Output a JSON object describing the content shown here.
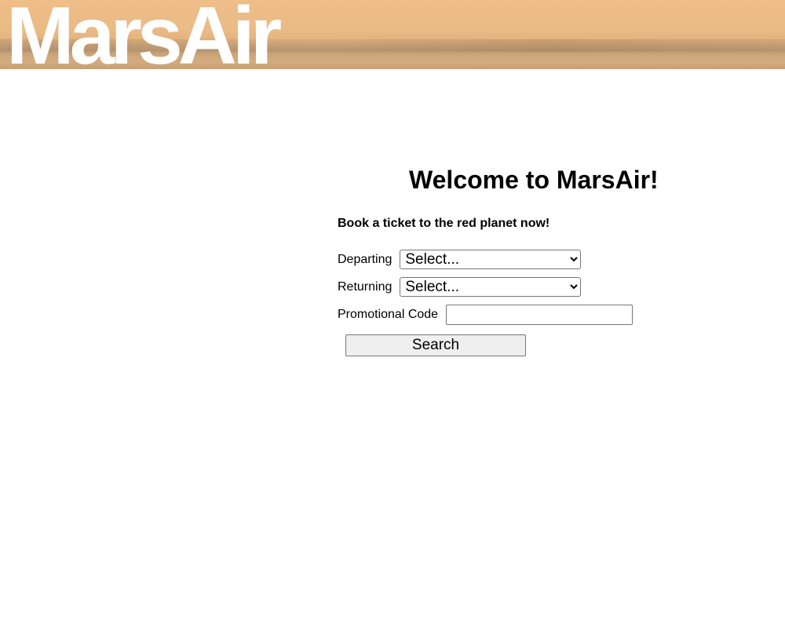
{
  "header": {
    "logo_text": "MarsAir"
  },
  "main": {
    "welcome_heading": "Welcome to MarsAir!",
    "tagline": "Book a ticket to the red planet now!",
    "form": {
      "departing_label": "Departing",
      "departing_value": "Select...",
      "returning_label": "Returning",
      "returning_value": "Select...",
      "promo_label": "Promotional Code",
      "promo_value": "",
      "promo_placeholder": "",
      "search_label": "Search"
    }
  },
  "colors": {
    "header_sand": "#ebbb86",
    "header_ground": "#c69e74",
    "logo": "#ffffff"
  }
}
